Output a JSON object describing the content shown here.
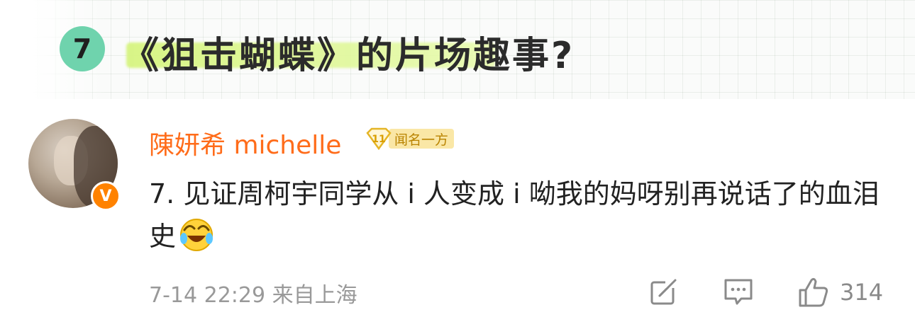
{
  "header": {
    "number": "7",
    "title": "《狙击蝴蝶》的片场趣事?"
  },
  "comment": {
    "username": "陳妍希 michelle",
    "level_number": "11",
    "level_label": "闻名一方",
    "verified_mark": "V",
    "text": "7. 见证周柯宇同学从 i 人变成 i 呦我的妈呀别再说话了的血泪史",
    "time": "7-14 22:29",
    "location": "来自上海",
    "likes": "314"
  },
  "colors": {
    "username": "#ff6c1a",
    "badge_green": "#6fd3ad",
    "highlight": "#d6f480",
    "verified": "#ff8200",
    "level_bg": "#fae7a6"
  },
  "icons": [
    "share-icon",
    "comment-icon",
    "like-icon",
    "laughing-crying-emoji"
  ]
}
